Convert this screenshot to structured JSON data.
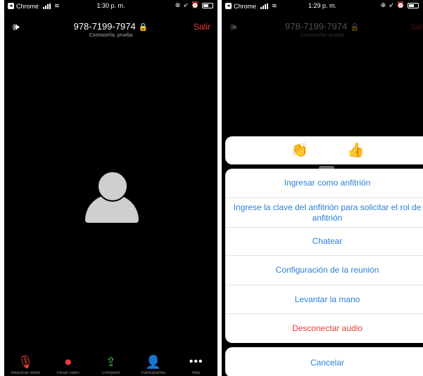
{
  "left": {
    "status": {
      "app": "Chrome",
      "time": "1:30 p. m."
    },
    "header": {
      "meeting_id": "978-7199-7974",
      "password": "Contraseña: prueba",
      "leave": "Salir"
    },
    "toolbar": {
      "items": [
        {
          "icon": "mic-muted-icon",
          "label": "Reactivar audio"
        },
        {
          "icon": "video-off-icon",
          "label": "Iniciar video"
        },
        {
          "icon": "share-icon",
          "label": "Compartir"
        },
        {
          "icon": "participants-icon",
          "label": "Participantes"
        },
        {
          "icon": "more-icon",
          "label": "Más"
        }
      ]
    }
  },
  "right": {
    "status": {
      "app": "Chrome",
      "time": "1:29 p. m."
    },
    "header": {
      "meeting_id": "978-7199-7974",
      "password": "Contraseña: prueba",
      "leave": "Salir"
    },
    "reactions": [
      "👏",
      "👍"
    ],
    "actions": [
      "Ingresar como anfitrión",
      "Ingrese la clave del anfitrión para solicitar el rol de anfitrión",
      "Chatear",
      "Configuración de la reunión",
      "Levantar la mano",
      "Desconectar audio"
    ],
    "cancel": "Cancelar"
  },
  "colors": {
    "accent_blue": "#2b80d9",
    "danger_red": "#e5403a",
    "share_green": "#3fbf4a"
  }
}
